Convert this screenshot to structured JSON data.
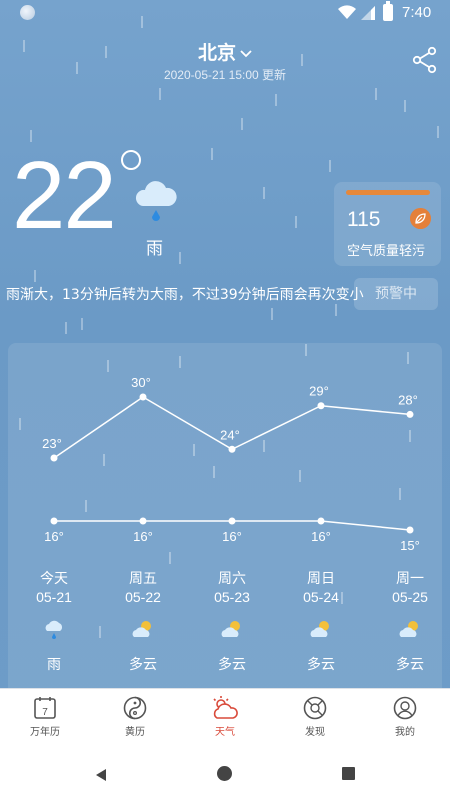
{
  "status": {
    "time": "7:40"
  },
  "header": {
    "city": "北京",
    "updated": "2020-05-21 15:00 更新"
  },
  "current": {
    "temperature": "22",
    "condition": "雨"
  },
  "aqi": {
    "value": "115",
    "label": "空气质量轻污",
    "bar_color": "#e6883b"
  },
  "alert": {
    "text": "雨渐大，13分钟后转为大雨，不过39分钟后雨会再次变小",
    "badge": "预警中"
  },
  "forecast": {
    "highs": [
      "23°",
      "30°",
      "24°",
      "29°",
      "28°"
    ],
    "lows": [
      "16°",
      "16°",
      "16°",
      "16°",
      "15°"
    ],
    "days": [
      {
        "name": "今天",
        "date": "05-21",
        "condition": "雨",
        "icon": "rain-icon"
      },
      {
        "name": "周五",
        "date": "05-22",
        "condition": "多云",
        "icon": "partly-cloudy-icon"
      },
      {
        "name": "周六",
        "date": "05-23",
        "condition": "多云",
        "icon": "partly-cloudy-icon"
      },
      {
        "name": "周日",
        "date": "05-24",
        "condition": "多云",
        "icon": "partly-cloudy-icon"
      },
      {
        "name": "周一",
        "date": "05-25",
        "condition": "多云",
        "icon": "partly-cloudy-icon"
      }
    ]
  },
  "chart_data": {
    "type": "line",
    "categories": [
      "05-21",
      "05-22",
      "05-23",
      "05-24",
      "05-25"
    ],
    "series": [
      {
        "values": [
          23,
          30,
          24,
          29,
          28
        ]
      },
      {
        "values": [
          16,
          16,
          16,
          16,
          15
        ]
      }
    ]
  },
  "nav": {
    "items": [
      {
        "label": "万年历",
        "icon": "calendar-icon",
        "badge": "7"
      },
      {
        "label": "黄历",
        "icon": "yinyang-icon"
      },
      {
        "label": "天气",
        "icon": "weather-icon",
        "active": true
      },
      {
        "label": "发现",
        "icon": "discover-icon"
      },
      {
        "label": "我的",
        "icon": "profile-icon"
      }
    ]
  },
  "colors": {
    "accent": "#d94a3a",
    "background": "#6f9dc9",
    "aqi": "#e4803a"
  }
}
